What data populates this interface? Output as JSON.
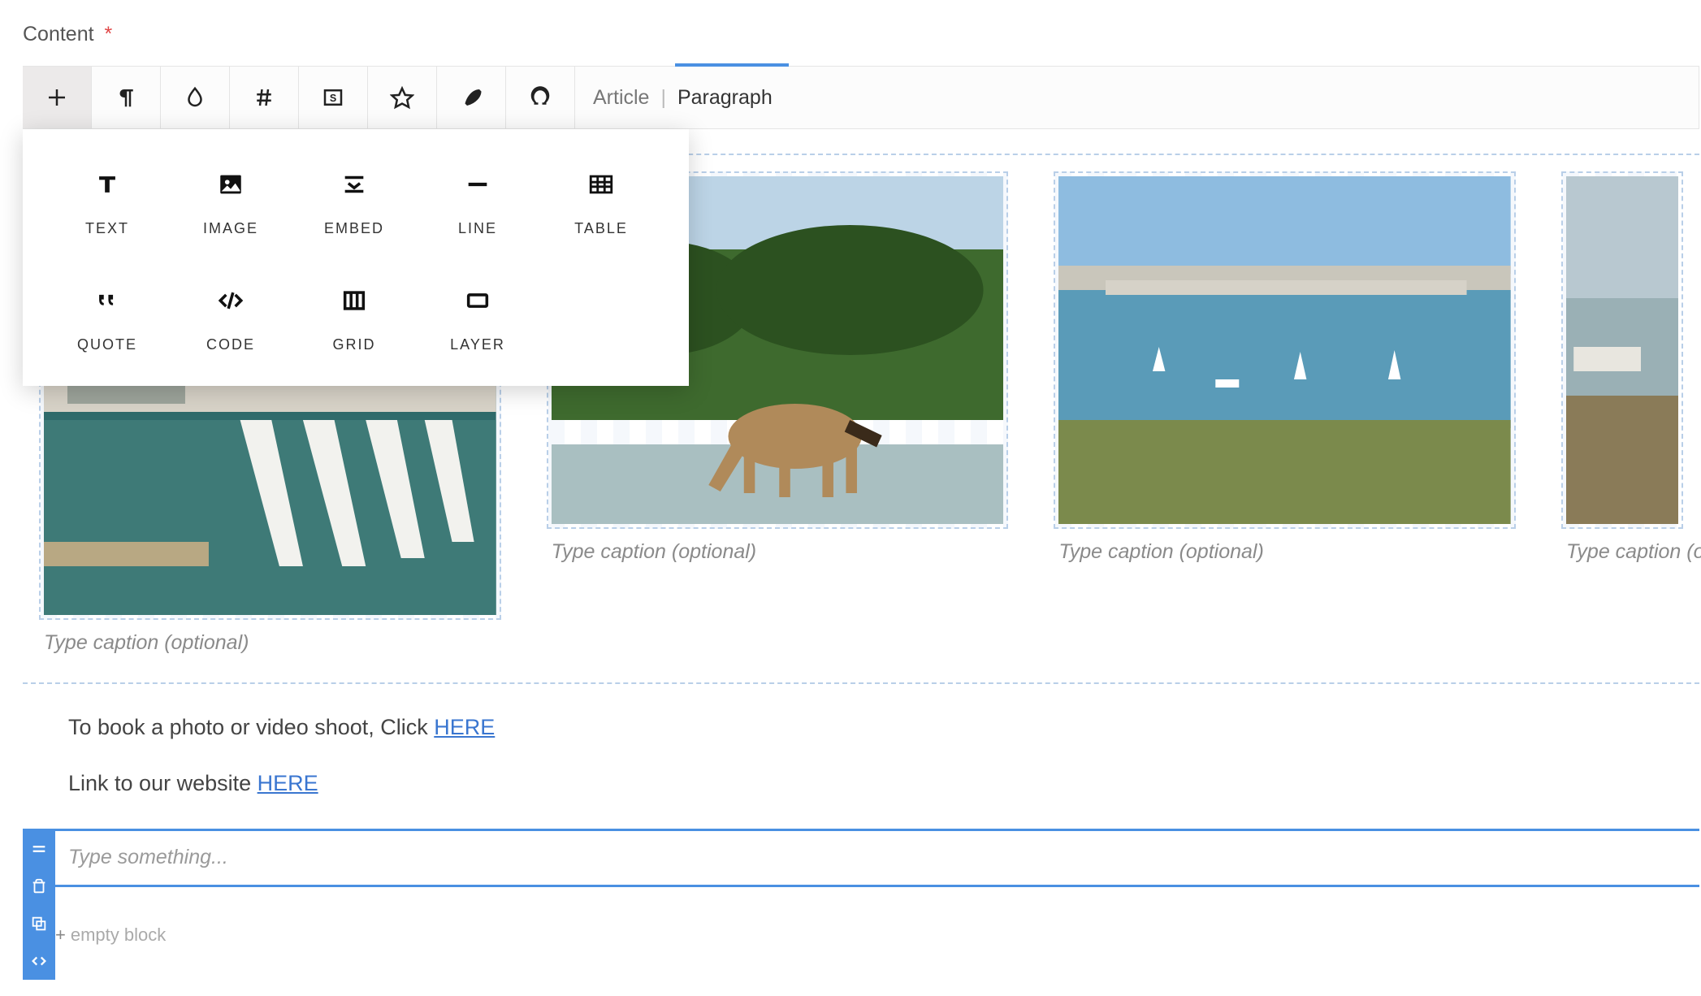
{
  "field": {
    "label": "Content",
    "required_mark": "*"
  },
  "toolbar": {
    "breadcrumb_root": "Article",
    "breadcrumb_current": "Paragraph",
    "buttons": {
      "add": "add-block",
      "paragraph": "paragraph-format",
      "drop": "format-drop",
      "hash": "hash",
      "snippet": "snippet",
      "star": "favorite",
      "feather": "feather",
      "omega": "special-char"
    }
  },
  "add_popover": {
    "items": [
      {
        "key": "text",
        "label": "TEXT"
      },
      {
        "key": "image",
        "label": "IMAGE"
      },
      {
        "key": "embed",
        "label": "EMBED"
      },
      {
        "key": "line",
        "label": "LINE"
      },
      {
        "key": "table",
        "label": "TABLE"
      },
      {
        "key": "quote",
        "label": "QUOTE"
      },
      {
        "key": "code",
        "label": "CODE"
      },
      {
        "key": "grid",
        "label": "GRID"
      },
      {
        "key": "layer",
        "label": "LAYER"
      }
    ]
  },
  "gallery": {
    "caption_placeholder": "Type caption (optional)"
  },
  "paragraphs": {
    "book_prefix": "To book a photo or video shoot, Click ",
    "book_link_text": "HERE",
    "website_prefix": "Link to our website ",
    "website_link_text": "HERE"
  },
  "active_block": {
    "placeholder": "Type something..."
  },
  "empty_block": {
    "label": "empty block"
  }
}
